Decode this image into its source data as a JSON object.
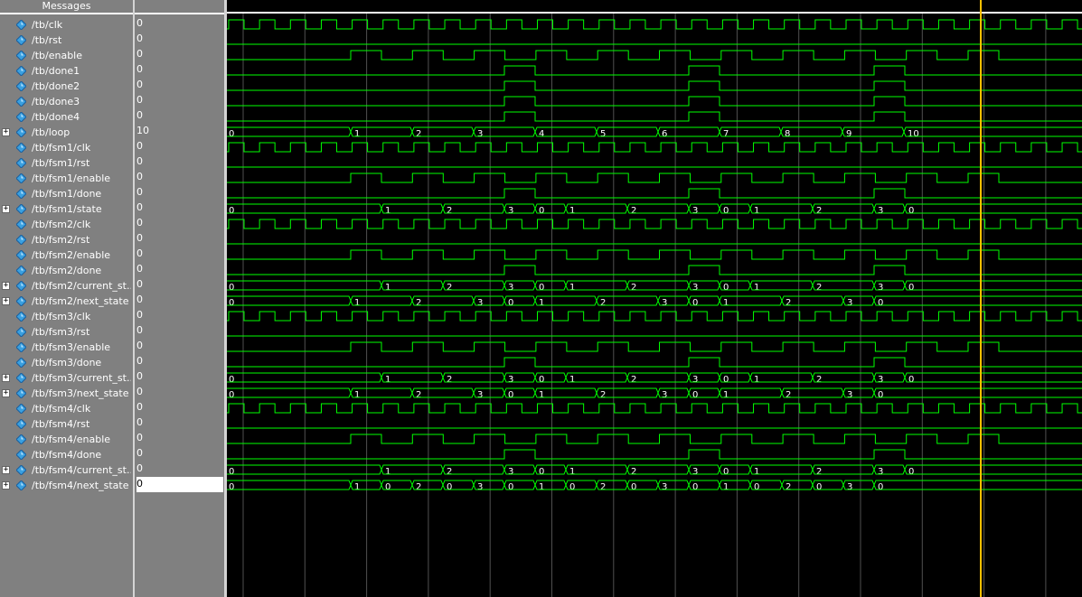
{
  "header": {
    "messages": "Messages"
  },
  "signals": [
    {
      "name": "/tb/clk",
      "value": "0",
      "expandable": false,
      "kind": "clk"
    },
    {
      "name": "/tb/rst",
      "value": "0",
      "expandable": false,
      "kind": "low"
    },
    {
      "name": "/tb/enable",
      "value": "0",
      "expandable": false,
      "kind": "en"
    },
    {
      "name": "/tb/done1",
      "value": "0",
      "expandable": false,
      "kind": "done"
    },
    {
      "name": "/tb/done2",
      "value": "0",
      "expandable": false,
      "kind": "done"
    },
    {
      "name": "/tb/done3",
      "value": "0",
      "expandable": false,
      "kind": "done"
    },
    {
      "name": "/tb/done4",
      "value": "0",
      "expandable": false,
      "kind": "done"
    },
    {
      "name": "/tb/loop",
      "value": "10",
      "expandable": true,
      "kind": "bus",
      "bus": "loop"
    },
    {
      "name": "/tb/fsm1/clk",
      "value": "0",
      "expandable": false,
      "kind": "clk"
    },
    {
      "name": "/tb/fsm1/rst",
      "value": "0",
      "expandable": false,
      "kind": "low"
    },
    {
      "name": "/tb/fsm1/enable",
      "value": "0",
      "expandable": false,
      "kind": "en"
    },
    {
      "name": "/tb/fsm1/done",
      "value": "0",
      "expandable": false,
      "kind": "done"
    },
    {
      "name": "/tb/fsm1/state",
      "value": "0",
      "expandable": true,
      "kind": "bus",
      "bus": "cur"
    },
    {
      "name": "/tb/fsm2/clk",
      "value": "0",
      "expandable": false,
      "kind": "clk"
    },
    {
      "name": "/tb/fsm2/rst",
      "value": "0",
      "expandable": false,
      "kind": "low"
    },
    {
      "name": "/tb/fsm2/enable",
      "value": "0",
      "expandable": false,
      "kind": "en"
    },
    {
      "name": "/tb/fsm2/done",
      "value": "0",
      "expandable": false,
      "kind": "done"
    },
    {
      "name": "/tb/fsm2/current_st...",
      "value": "0",
      "expandable": true,
      "kind": "bus",
      "bus": "cur"
    },
    {
      "name": "/tb/fsm2/next_state",
      "value": "0",
      "expandable": true,
      "kind": "bus",
      "bus": "next"
    },
    {
      "name": "/tb/fsm3/clk",
      "value": "0",
      "expandable": false,
      "kind": "clk"
    },
    {
      "name": "/tb/fsm3/rst",
      "value": "0",
      "expandable": false,
      "kind": "low"
    },
    {
      "name": "/tb/fsm3/enable",
      "value": "0",
      "expandable": false,
      "kind": "en"
    },
    {
      "name": "/tb/fsm3/done",
      "value": "0",
      "expandable": false,
      "kind": "done"
    },
    {
      "name": "/tb/fsm3/current_st...",
      "value": "0",
      "expandable": true,
      "kind": "bus",
      "bus": "cur"
    },
    {
      "name": "/tb/fsm3/next_state",
      "value": "0",
      "expandable": true,
      "kind": "bus",
      "bus": "next"
    },
    {
      "name": "/tb/fsm4/clk",
      "value": "0",
      "expandable": false,
      "kind": "clk"
    },
    {
      "name": "/tb/fsm4/rst",
      "value": "0",
      "expandable": false,
      "kind": "low"
    },
    {
      "name": "/tb/fsm4/enable",
      "value": "0",
      "expandable": false,
      "kind": "en"
    },
    {
      "name": "/tb/fsm4/done",
      "value": "0",
      "expandable": false,
      "kind": "done4"
    },
    {
      "name": "/tb/fsm4/current_st...",
      "value": "0",
      "expandable": true,
      "kind": "bus",
      "bus": "cur"
    },
    {
      "name": "/tb/fsm4/next_state",
      "value": "0",
      "expandable": true,
      "kind": "bus",
      "bus": "next4",
      "selected": true
    }
  ],
  "bus_values": {
    "loop": [
      "0",
      "1",
      "2",
      "3",
      "4",
      "5",
      "6",
      "7",
      "8",
      "9",
      "10"
    ],
    "cur": [
      "0",
      "1",
      "2",
      "3",
      "0",
      "1",
      "2",
      "3",
      "0",
      "1",
      "2",
      "3",
      "0"
    ],
    "next": [
      "0",
      "1",
      "2",
      "3",
      "0",
      "1",
      "2",
      "3",
      "0",
      "1",
      "2",
      "3",
      "0"
    ],
    "next4": [
      "0",
      "1",
      "0",
      "2",
      "0",
      "3",
      "0",
      "1",
      "0",
      "2",
      "0",
      "3",
      "0",
      "1",
      "0",
      "2",
      "0",
      "3",
      "0"
    ]
  },
  "colors": {
    "wave": "#00ff00",
    "cursor": "#ffc000",
    "grid": "#505050",
    "panel": "#808080",
    "icon": "#3aa0e0"
  }
}
